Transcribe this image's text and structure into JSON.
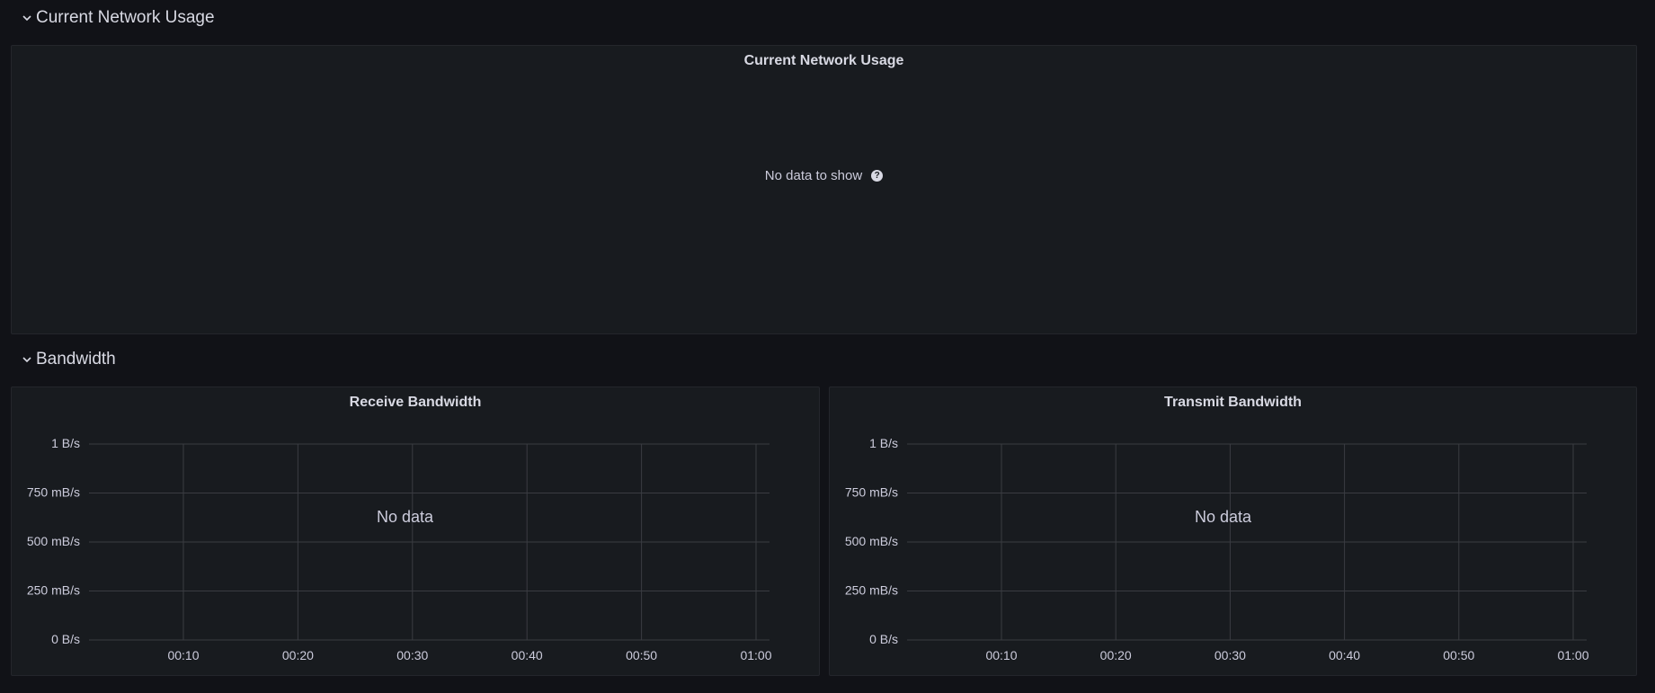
{
  "rows": [
    {
      "title": "Current Network Usage"
    },
    {
      "title": "Bandwidth"
    }
  ],
  "current_usage_panel": {
    "title": "Current Network Usage",
    "message": "No data to show"
  },
  "bandwidth_panels": [
    {
      "title": "Receive Bandwidth",
      "message": "No data"
    },
    {
      "title": "Transmit Bandwidth",
      "message": "No data"
    }
  ],
  "chart_data": [
    {
      "type": "line",
      "title": "Receive Bandwidth",
      "series": [],
      "y_ticks": [
        "0 B/s",
        "250 mB/s",
        "500 mB/s",
        "750 mB/s",
        "1 B/s"
      ],
      "x_ticks": [
        "00:10",
        "00:20",
        "00:30",
        "00:40",
        "00:50",
        "01:00"
      ],
      "ylim": [
        0,
        1
      ],
      "grid": true
    },
    {
      "type": "line",
      "title": "Transmit Bandwidth",
      "series": [],
      "y_ticks": [
        "0 B/s",
        "250 mB/s",
        "500 mB/s",
        "750 mB/s",
        "1 B/s"
      ],
      "x_ticks": [
        "00:10",
        "00:20",
        "00:30",
        "00:40",
        "00:50",
        "01:00"
      ],
      "ylim": [
        0,
        1
      ],
      "grid": true
    }
  ],
  "colors": {
    "background": "#111217",
    "panel": "#181b1f",
    "grid": "#3a3c42",
    "text": "#ccccdc"
  }
}
